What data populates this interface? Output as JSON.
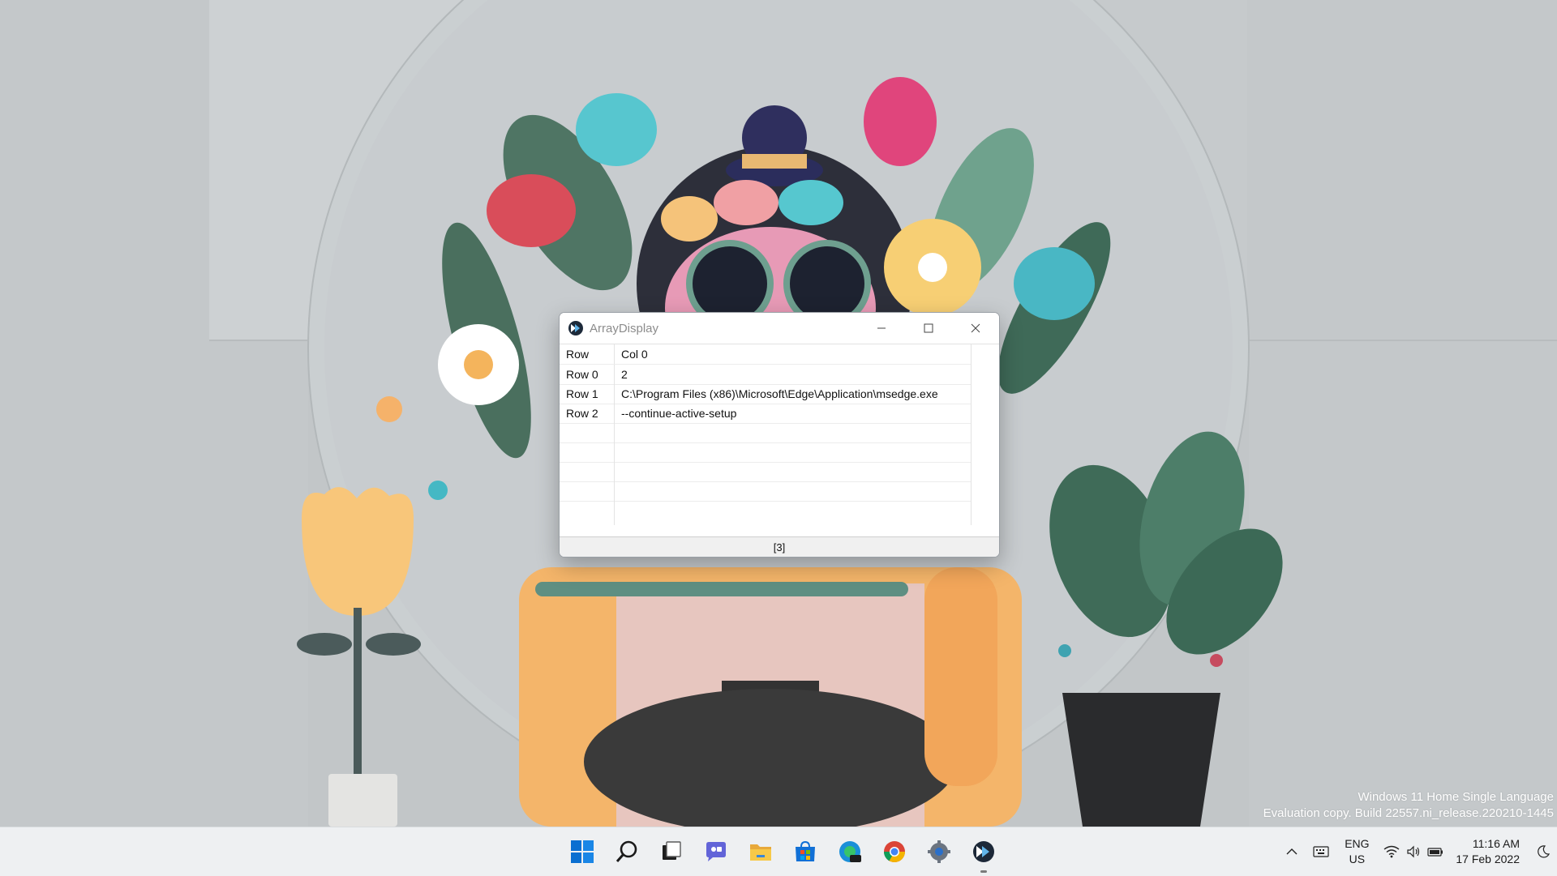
{
  "window": {
    "title": "ArrayDisplay",
    "header": {
      "row": "Row",
      "col0": "Col 0"
    },
    "rows": [
      {
        "label": "Row 0",
        "value": "2"
      },
      {
        "label": "Row 1",
        "value": "C:\\Program Files (x86)\\Microsoft\\Edge\\Application\\msedge.exe"
      },
      {
        "label": "Row 2",
        "value": "--continue-active-setup"
      }
    ],
    "status": "[3]"
  },
  "watermark": {
    "line1": "Windows 11 Home Single Language",
    "line2": "Evaluation copy. Build 22557.ni_release.220210-1445"
  },
  "taskbar": {
    "apps": [
      "windows-start-icon",
      "search-icon",
      "task-view-icon",
      "chat-icon",
      "file-explorer-icon",
      "microsoft-store-icon",
      "edge-dev-icon",
      "chrome-icon",
      "settings-icon",
      "autoit-icon"
    ],
    "language": {
      "line1": "ENG",
      "line2": "US"
    },
    "time": "11:16 AM",
    "date": "17 Feb 2022"
  },
  "colors": {
    "accent": "#0078d4",
    "taskbar": "#eef0f2"
  }
}
